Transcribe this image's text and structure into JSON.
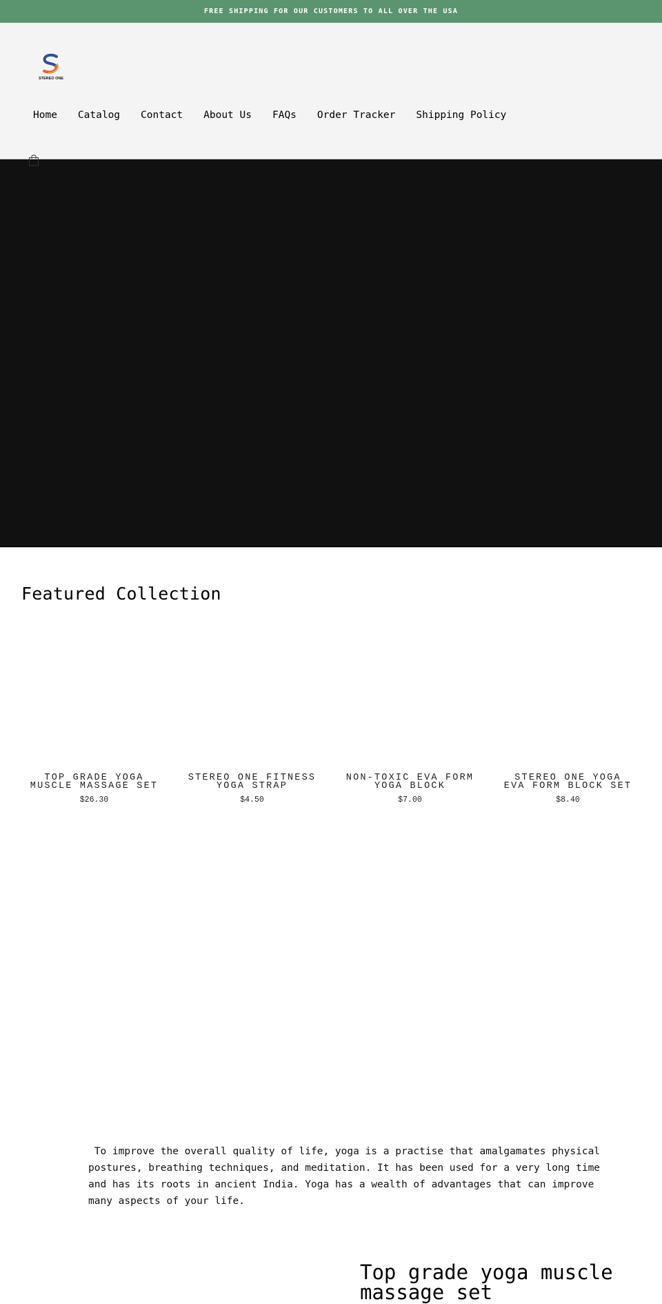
{
  "announcement": {
    "text": "FREE SHIPPING FOR OUR CUSTOMERS TO ALL OVER THE USA",
    "background_color": "#5a9570"
  },
  "header": {
    "logo_alt": "STEREO ONE",
    "logo_text": "STEREO ONE",
    "nav": [
      {
        "label": "Home"
      },
      {
        "label": "Catalog"
      },
      {
        "label": "Contact"
      },
      {
        "label": "About Us"
      },
      {
        "label": "FAQs"
      },
      {
        "label": "Order Tracker"
      },
      {
        "label": "Shipping Policy"
      }
    ],
    "cart_icon": "shopping-bag-icon"
  },
  "hero": {
    "background_color": "#111111"
  },
  "featured_collection": {
    "title": "Featured Collection",
    "products": [
      {
        "title": "TOP GRADE YOGA MUSCLE MASSAGE SET",
        "price": "$26.30"
      },
      {
        "title": "STEREO ONE FITNESS YOGA STRAP",
        "price": "$4.50"
      },
      {
        "title": "NON-TOXIC EVA FORM YOGA BLOCK",
        "price": "$7.00"
      },
      {
        "title": "STEREO ONE YOGA EVA FORM BLOCK SET",
        "price": "$8.40"
      }
    ]
  },
  "rich_text": {
    "body": " To improve the overall quality of life, yoga is a practise that amalgamates physical postures, breathing techniques, and meditation. It has been used for a very long time and has its roots in ancient India. Yoga has a wealth of advantages that can improve many aspects of your life."
  },
  "featured_product": {
    "title": "Top grade yoga muscle massage set"
  }
}
